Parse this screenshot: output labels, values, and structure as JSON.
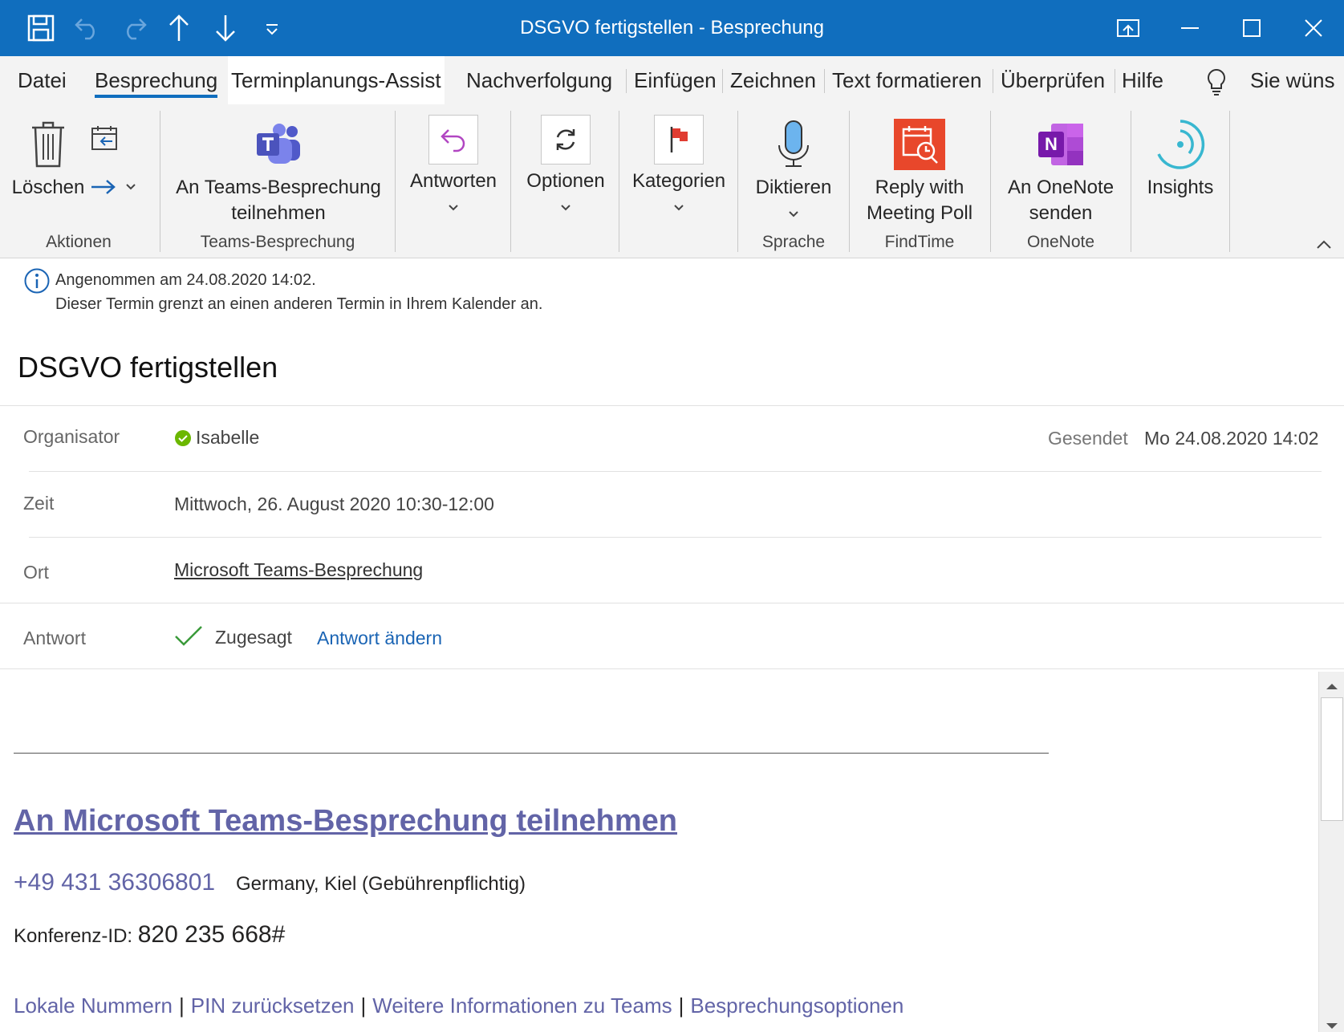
{
  "window": {
    "title": "DSGVO fertigstellen  -  Besprechung"
  },
  "quick_access": {
    "icons": [
      "save-icon",
      "undo-icon",
      "redo-icon",
      "arrow-up-icon",
      "arrow-down-icon",
      "customize-icon"
    ]
  },
  "tabs": [
    {
      "label": "Datei"
    },
    {
      "label": "Besprechung"
    },
    {
      "label": "Terminplanungs-Assist"
    },
    {
      "label": "Nachverfolgung"
    },
    {
      "label": "Einfügen"
    },
    {
      "label": "Zeichnen"
    },
    {
      "label": "Text formatieren"
    },
    {
      "label": "Überprüfen"
    },
    {
      "label": "Hilfe"
    }
  ],
  "tell_me": "Sie wüns",
  "ribbon": {
    "delete_label": "Löschen",
    "teams_label_1": "An Teams-Besprechung",
    "teams_label_2": "teilnehmen",
    "reply_label": "Antworten",
    "options_label": "Optionen",
    "categories_label": "Kategorien",
    "dictate_label": "Diktieren",
    "poll_label_1": "Reply with",
    "poll_label_2": "Meeting Poll",
    "onenote_label_1": "An OneNote",
    "onenote_label_2": "senden",
    "insights_label": "Insights",
    "groups": {
      "actions": "Aktionen",
      "teams": "Teams-Besprechung",
      "speech": "Sprache",
      "findtime": "FindTime",
      "onenote": "OneNote"
    }
  },
  "info": {
    "line1": "Angenommen am 24.08.2020 14:02.",
    "line2": "Dieser Termin grenzt an einen anderen Termin in Ihrem Kalender an."
  },
  "subject": "DSGVO fertigstellen",
  "fields": {
    "organizer_label": "Organisator",
    "organizer_value": "Isabelle",
    "sent_label": "Gesendet",
    "sent_value": "Mo 24.08.2020 14:02",
    "time_label": "Zeit",
    "time_value": "Mittwoch, 26. August 2020 10:30-12:00",
    "location_label": "Ort",
    "location_value": "Microsoft Teams-Besprechung",
    "response_label": "Antwort",
    "response_value": "Zugesagt",
    "change_response": "Antwort ändern"
  },
  "body": {
    "join_link": "An Microsoft Teams-Besprechung teilnehmen",
    "phone": "+49 431 36306801",
    "phone_location": "Germany, Kiel (Gebührenpflichtig)",
    "conf_label": "Konferenz-ID:",
    "conf_id": "820 235 668#",
    "links": [
      "Lokale Nummern",
      "PIN zurücksetzen",
      "Weitere Informationen zu Teams",
      "Besprechungsoptionen"
    ]
  },
  "colors": {
    "titlebar": "#106ebe",
    "teams_purple": "#6264a7",
    "link_blue": "#1a64b4",
    "status_green": "#4caf50"
  }
}
